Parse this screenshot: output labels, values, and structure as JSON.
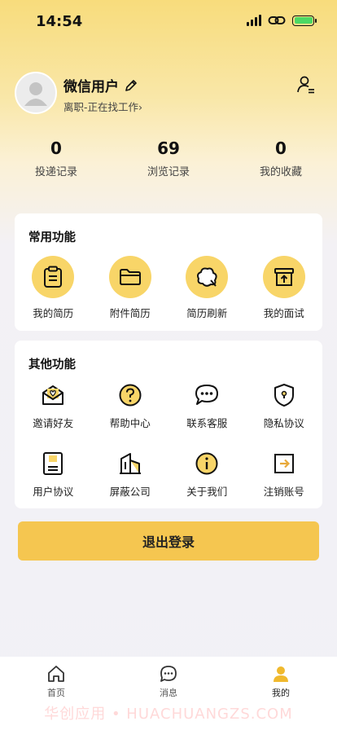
{
  "status_bar": {
    "time": "14:54"
  },
  "profile": {
    "name": "微信用户",
    "status": "离职-正在找工作",
    "status_arrow": "›"
  },
  "stats": [
    {
      "value": "0",
      "label": "投递记录"
    },
    {
      "value": "69",
      "label": "浏览记录"
    },
    {
      "value": "0",
      "label": "我的收藏"
    }
  ],
  "common_functions": {
    "title": "常用功能",
    "items": [
      {
        "label": "我的简历",
        "icon": "clipboard-icon"
      },
      {
        "label": "附件简历",
        "icon": "folder-icon"
      },
      {
        "label": "简历刷新",
        "icon": "refresh-cloud-icon"
      },
      {
        "label": "我的面试",
        "icon": "inbox-upload-icon"
      }
    ]
  },
  "other_functions": {
    "title": "其他功能",
    "items": [
      {
        "label": "邀请好友",
        "icon": "invite-envelope-icon"
      },
      {
        "label": "帮助中心",
        "icon": "help-question-icon"
      },
      {
        "label": "联系客服",
        "icon": "chat-bubble-icon"
      },
      {
        "label": "隐私协议",
        "icon": "shield-lock-icon"
      },
      {
        "label": "用户协议",
        "icon": "document-icon"
      },
      {
        "label": "屏蔽公司",
        "icon": "building-icon"
      },
      {
        "label": "关于我们",
        "icon": "info-icon"
      },
      {
        "label": "注销账号",
        "icon": "logout-box-icon"
      }
    ]
  },
  "logout": {
    "label": "退出登录"
  },
  "tabbar": {
    "items": [
      {
        "label": "首页",
        "icon": "home-icon"
      },
      {
        "label": "消息",
        "icon": "message-icon"
      },
      {
        "label": "我的",
        "icon": "user-icon"
      }
    ]
  },
  "watermark": "华创应用 • HUACHUANGZS.COM",
  "colors": {
    "accent": "#f8d568",
    "button": "#f5c650",
    "active_tab": "#f0b92e"
  }
}
